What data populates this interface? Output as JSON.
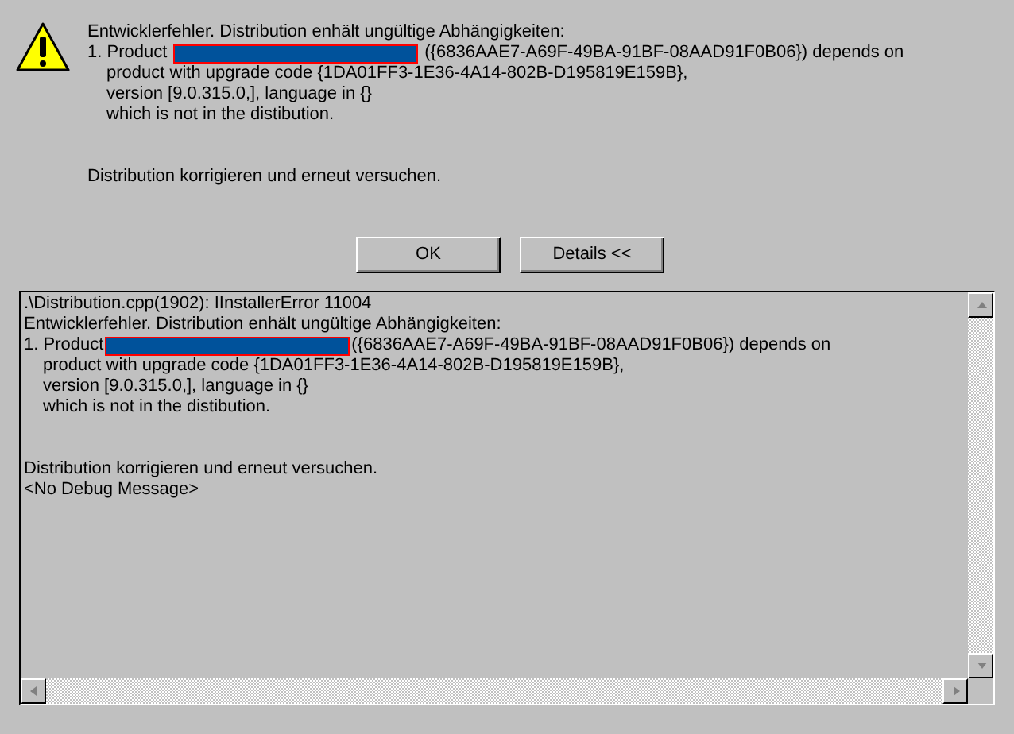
{
  "message": {
    "lines": [
      {
        "kind": "text",
        "text": "Entwicklerfehler. Distribution enhält ungültige Abhängigkeiten:"
      },
      {
        "kind": "redacted",
        "text": "1. Product",
        "after": "({6836AAE7-A69F-49BA-91BF-08AAD91F0B06}) depends on"
      },
      {
        "kind": "indented",
        "text": "product with upgrade code {1DA01FF3-1E36-4A14-802B-D195819E159B},"
      },
      {
        "kind": "indented",
        "text": "version [9.0.315.0,], language in {}"
      },
      {
        "kind": "indented",
        "text": "which is not in the distibution."
      },
      {
        "kind": "blank"
      },
      {
        "kind": "blank"
      },
      {
        "kind": "text",
        "text": "Distribution korrigieren und erneut versuchen."
      }
    ]
  },
  "buttons": [
    {
      "label": "OK"
    },
    {
      "label": "Details <<"
    }
  ],
  "details": {
    "lines": [
      {
        "kind": "text",
        "text": ".\\Distribution.cpp(1902): IInstallerError 11004"
      },
      {
        "kind": "text",
        "text": "Entwicklerfehler. Distribution enhält ungültige Abhängigkeiten:"
      },
      {
        "kind": "redacted",
        "text": "1. Product",
        "after": "({6836AAE7-A69F-49BA-91BF-08AAD91F0B06}) depends on"
      },
      {
        "kind": "indented",
        "text": "product with upgrade code {1DA01FF3-1E36-4A14-802B-D195819E159B},"
      },
      {
        "kind": "indented",
        "text": "version [9.0.315.0,], language in {}"
      },
      {
        "kind": "indented",
        "text": "which is not in the distibution."
      },
      {
        "kind": "blank"
      },
      {
        "kind": "blank"
      },
      {
        "kind": "text",
        "text": "Distribution korrigieren und erneut versuchen."
      },
      {
        "kind": "text",
        "text": "<No Debug Message>"
      }
    ]
  }
}
